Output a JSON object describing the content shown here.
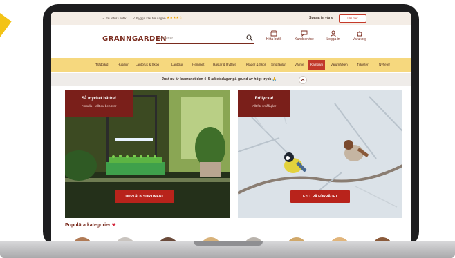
{
  "colors": {
    "stripe": "#f3c316",
    "brand": "#7a2b1e",
    "nav_bar": "#f6d87e",
    "accent_red": "#b8231b",
    "promo_box": "#7a1f1a"
  },
  "topbar": {
    "usps": [
      "Fri retur i butik",
      "Bygga klar för dagen"
    ],
    "rating_stars": "★★★★☆",
    "rating_text": "",
    "explore_label": "Spana in våra",
    "read_button": "Läs mer"
  },
  "header": {
    "logo": "GRANNGARDEN",
    "search_placeholder": "Sök efter",
    "icons": [
      {
        "name": "store-icon",
        "label": "Hitta butik"
      },
      {
        "name": "chat-icon",
        "label": "Kundservice"
      },
      {
        "name": "user-icon",
        "label": "Logga in"
      },
      {
        "name": "cart-icon",
        "label": "Varukorg"
      }
    ]
  },
  "nav": {
    "items": [
      "Trädgård",
      "Husdjur",
      "Lantbruk & Skog",
      "Lantdjur",
      "Hemmet",
      "Hästar & Ryttare",
      "Kläder & Skor",
      "Småfåglar",
      "Värme",
      "Kampanj",
      "Varumärken",
      "Tjänster",
      "Nyheter"
    ],
    "active": "Kampanj"
  },
  "notice": {
    "text": "Just nu är leveranstiden 4–5 arbetsdagar på grund av högt tryck 🙏"
  },
  "promo_left": {
    "title": "Så mycket bättre!",
    "subtitle": "Förodla – allt du behöver",
    "cta": "UPPTÄCK SORTIMENT"
  },
  "promo_right": {
    "title": "Frölycka!",
    "subtitle": "Allt för småfåglar",
    "cta": "FYLL PÅ FÖRRÅDET"
  },
  "categories": {
    "title": "Populära kategorier",
    "heart": "❤"
  }
}
